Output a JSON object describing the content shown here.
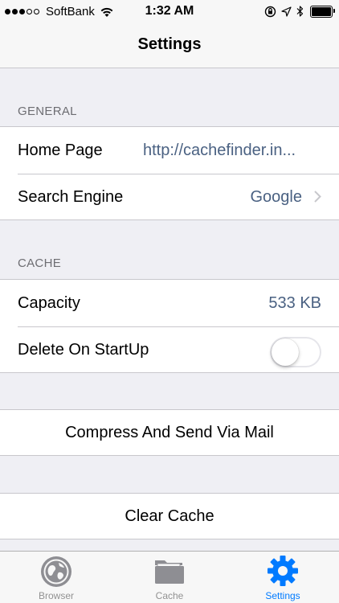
{
  "status_bar": {
    "carrier": "SoftBank",
    "time": "1:32 AM",
    "signal_bars_filled": 3,
    "signal_bars_total": 5,
    "battery_level": 1.0,
    "icons": [
      "wifi-icon",
      "orientation-lock-icon",
      "location-arrow-icon",
      "bluetooth-icon",
      "battery-icon"
    ]
  },
  "nav": {
    "title": "Settings"
  },
  "sections": {
    "general": {
      "header": "GENERAL",
      "home_page_label": "Home Page",
      "home_page_value": "http://cachefinder.in...",
      "search_engine_label": "Search Engine",
      "search_engine_value": "Google"
    },
    "cache": {
      "header": "CACHE",
      "capacity_label": "Capacity",
      "capacity_value": "533 KB",
      "delete_on_startup_label": "Delete On StartUp",
      "delete_on_startup_enabled": false
    }
  },
  "actions": {
    "compress_label": "Compress And Send Via Mail",
    "clear_cache_label": "Clear Cache"
  },
  "tab_bar": {
    "tabs": [
      {
        "label": "Browser",
        "icon": "globe-icon",
        "active": false
      },
      {
        "label": "Cache",
        "icon": "folder-icon",
        "active": false
      },
      {
        "label": "Settings",
        "icon": "gear-icon",
        "active": true
      }
    ]
  },
  "colors": {
    "accent": "#007aff",
    "detail_text": "#4a6182",
    "background": "#efeff4",
    "inactive_tab": "#929292"
  }
}
